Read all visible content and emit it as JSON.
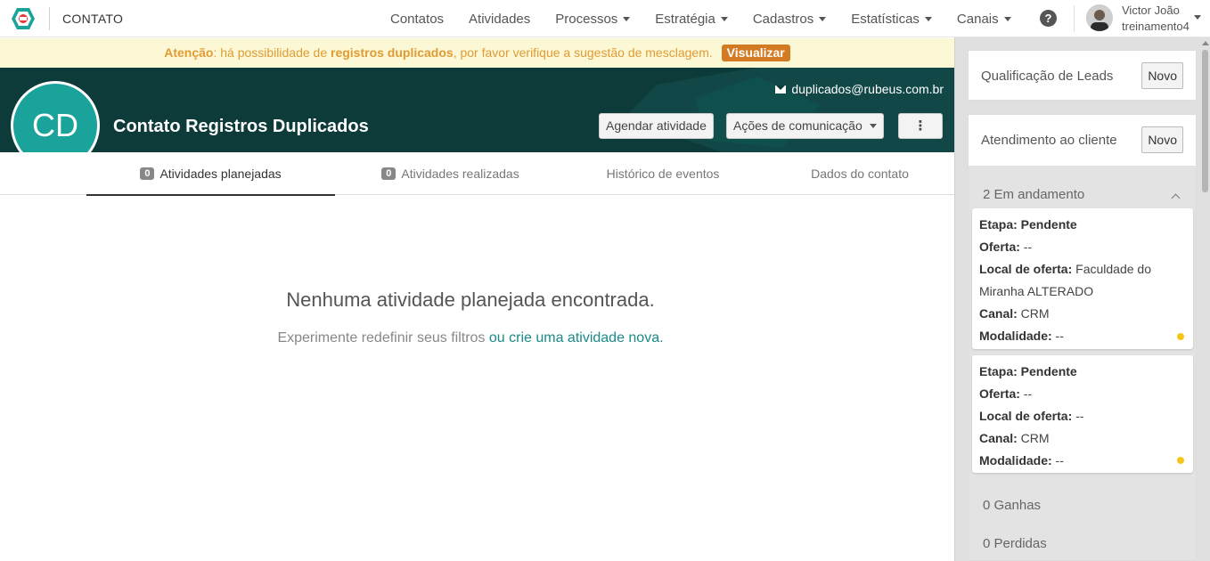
{
  "app": {
    "title": "CONTATO"
  },
  "nav": {
    "items": [
      {
        "label": "Contatos",
        "dropdown": false
      },
      {
        "label": "Atividades",
        "dropdown": false
      },
      {
        "label": "Processos",
        "dropdown": true
      },
      {
        "label": "Estratégia",
        "dropdown": true
      },
      {
        "label": "Cadastros",
        "dropdown": true
      },
      {
        "label": "Estatísticas",
        "dropdown": true
      },
      {
        "label": "Canais",
        "dropdown": true
      }
    ],
    "help": "?"
  },
  "user": {
    "name": "Victor João",
    "account": "treinamento4"
  },
  "alert": {
    "prefix": "Atenção",
    "text1": ": há possibilidade de ",
    "bold": "registros duplicados",
    "text2": ", por favor verifique a sugestão de mesclagem.",
    "button": "Visualizar"
  },
  "contact": {
    "initials": "CD",
    "name": "Contato Registros Duplicados",
    "email": "duplicados@rubeus.com.br"
  },
  "actions": {
    "schedule": "Agendar atividade",
    "communication": "Ações de comunicação",
    "more": "⋮"
  },
  "tabs": [
    {
      "label": "Atividades planejadas",
      "badge": "0"
    },
    {
      "label": "Atividades realizadas",
      "badge": "0"
    },
    {
      "label": "Histórico de eventos"
    },
    {
      "label": "Dados do contato"
    }
  ],
  "empty": {
    "title": "Nenhuma atividade planejada encontrada.",
    "sub": "Experimente redefinir seus filtros ",
    "link": "ou crie uma atividade nova."
  },
  "sidebar": {
    "qualificacao": {
      "title": "Qualificação de Leads",
      "button": "Novo"
    },
    "atendimento": {
      "title": "Atendimento ao cliente",
      "button": "Novo",
      "em_andamento": "2 Em andamento",
      "cards": [
        {
          "etapa_label": "Etapa: Pendente",
          "oferta_label": "Oferta:",
          "oferta": " --",
          "local_label": "Local de oferta:",
          "local": " Faculdade do Miranha ALTERADO",
          "canal_label": "Canal:",
          "canal": " CRM",
          "modalidade_label": "Modalidade:",
          "modalidade": " --"
        },
        {
          "etapa_label": "Etapa: Pendente",
          "oferta_label": "Oferta:",
          "oferta": " --",
          "local_label": "Local de oferta:",
          "local": " --",
          "canal_label": "Canal:",
          "canal": " CRM",
          "modalidade_label": "Modalidade:",
          "modalidade": " --"
        }
      ],
      "ganhas": "0 Ganhas",
      "perdidas": "0 Perdidas"
    }
  },
  "colors": {
    "header_bg": "#0d3b3a",
    "avatar_bg": "#1aa39a",
    "alert_bg": "#fcf8d5",
    "alert_text": "#e09b34",
    "alert_button": "#d27b22",
    "status_dot": "#f5c518"
  }
}
